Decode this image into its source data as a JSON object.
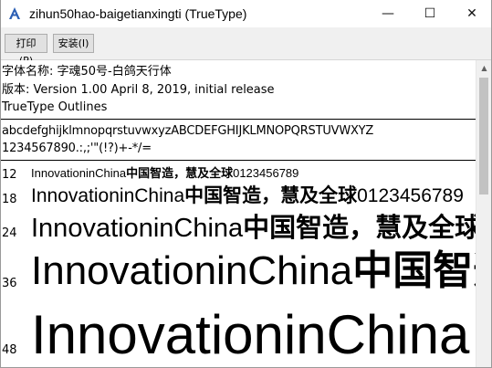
{
  "window": {
    "title": "zihun50hao-baigetianxingti (TrueType)",
    "minimize_glyph": "—",
    "maximize_glyph": "☐",
    "close_glyph": "✕"
  },
  "toolbar": {
    "print_label": "打印(P)",
    "install_label": "安装(I)"
  },
  "info": {
    "font_name": "字体名称: 字魂50号-白鸽天行体",
    "version": "版本: Version 1.00 April 8, 2019, initial release",
    "outline_type": "TrueType Outlines"
  },
  "charset": {
    "letters": "abcdefghijklmnopqrstuvwxyzABCDEFGHIJKLMNOPQRSTUVWXYZ",
    "digits_symbols": "1234567890.:,;'\"(!?)+-*/="
  },
  "samples": [
    {
      "size": "12",
      "latin": "InnovationinChina",
      "cjk": "中国智造，慧及全球",
      "tail": "0123456789"
    },
    {
      "size": "18",
      "latin": "InnovationinChina",
      "cjk": "中国智造，慧及全球",
      "tail": "0123456789"
    },
    {
      "size": "24",
      "latin": "InnovationinChina",
      "cjk": "中国智造，慧及全球",
      "tail": ""
    },
    {
      "size": "36",
      "latin": "InnovationinChina",
      "cjk": "中国智造",
      "tail": ""
    },
    {
      "size": "48",
      "latin": "InnovationinChina",
      "cjk": "",
      "tail": ""
    }
  ],
  "colors": {
    "toolbar_bg": "#f0f0f0",
    "button_bg": "#e1e1e1",
    "scrollbar_thumb": "#c2c2c2"
  }
}
